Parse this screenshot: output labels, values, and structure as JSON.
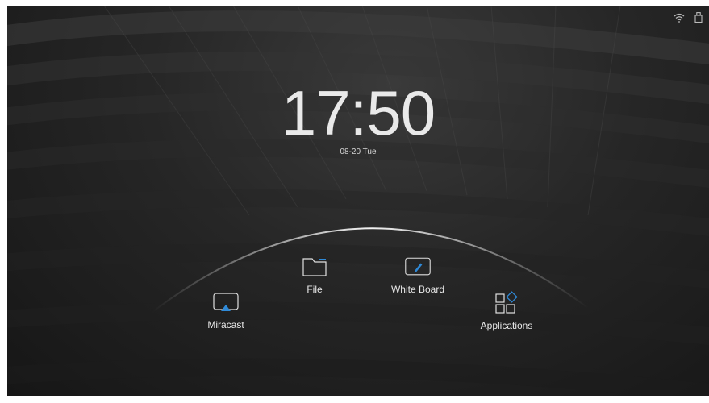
{
  "clock": {
    "time": "17:50",
    "date": "08-20  Tue"
  },
  "status_bar": {
    "icons": [
      "wifi-icon",
      "storage-icon"
    ]
  },
  "apps": {
    "miracast": {
      "label": "Miracast",
      "icon": "miracast-icon"
    },
    "file": {
      "label": "File",
      "icon": "folder-icon"
    },
    "white_board": {
      "label": "White Board",
      "icon": "whiteboard-icon"
    },
    "applications": {
      "label": "Applications",
      "icon": "apps-grid-icon"
    }
  },
  "colors": {
    "accent": "#2f8ad8",
    "text": "#e8e8e8",
    "background": "#1e1e1e"
  }
}
